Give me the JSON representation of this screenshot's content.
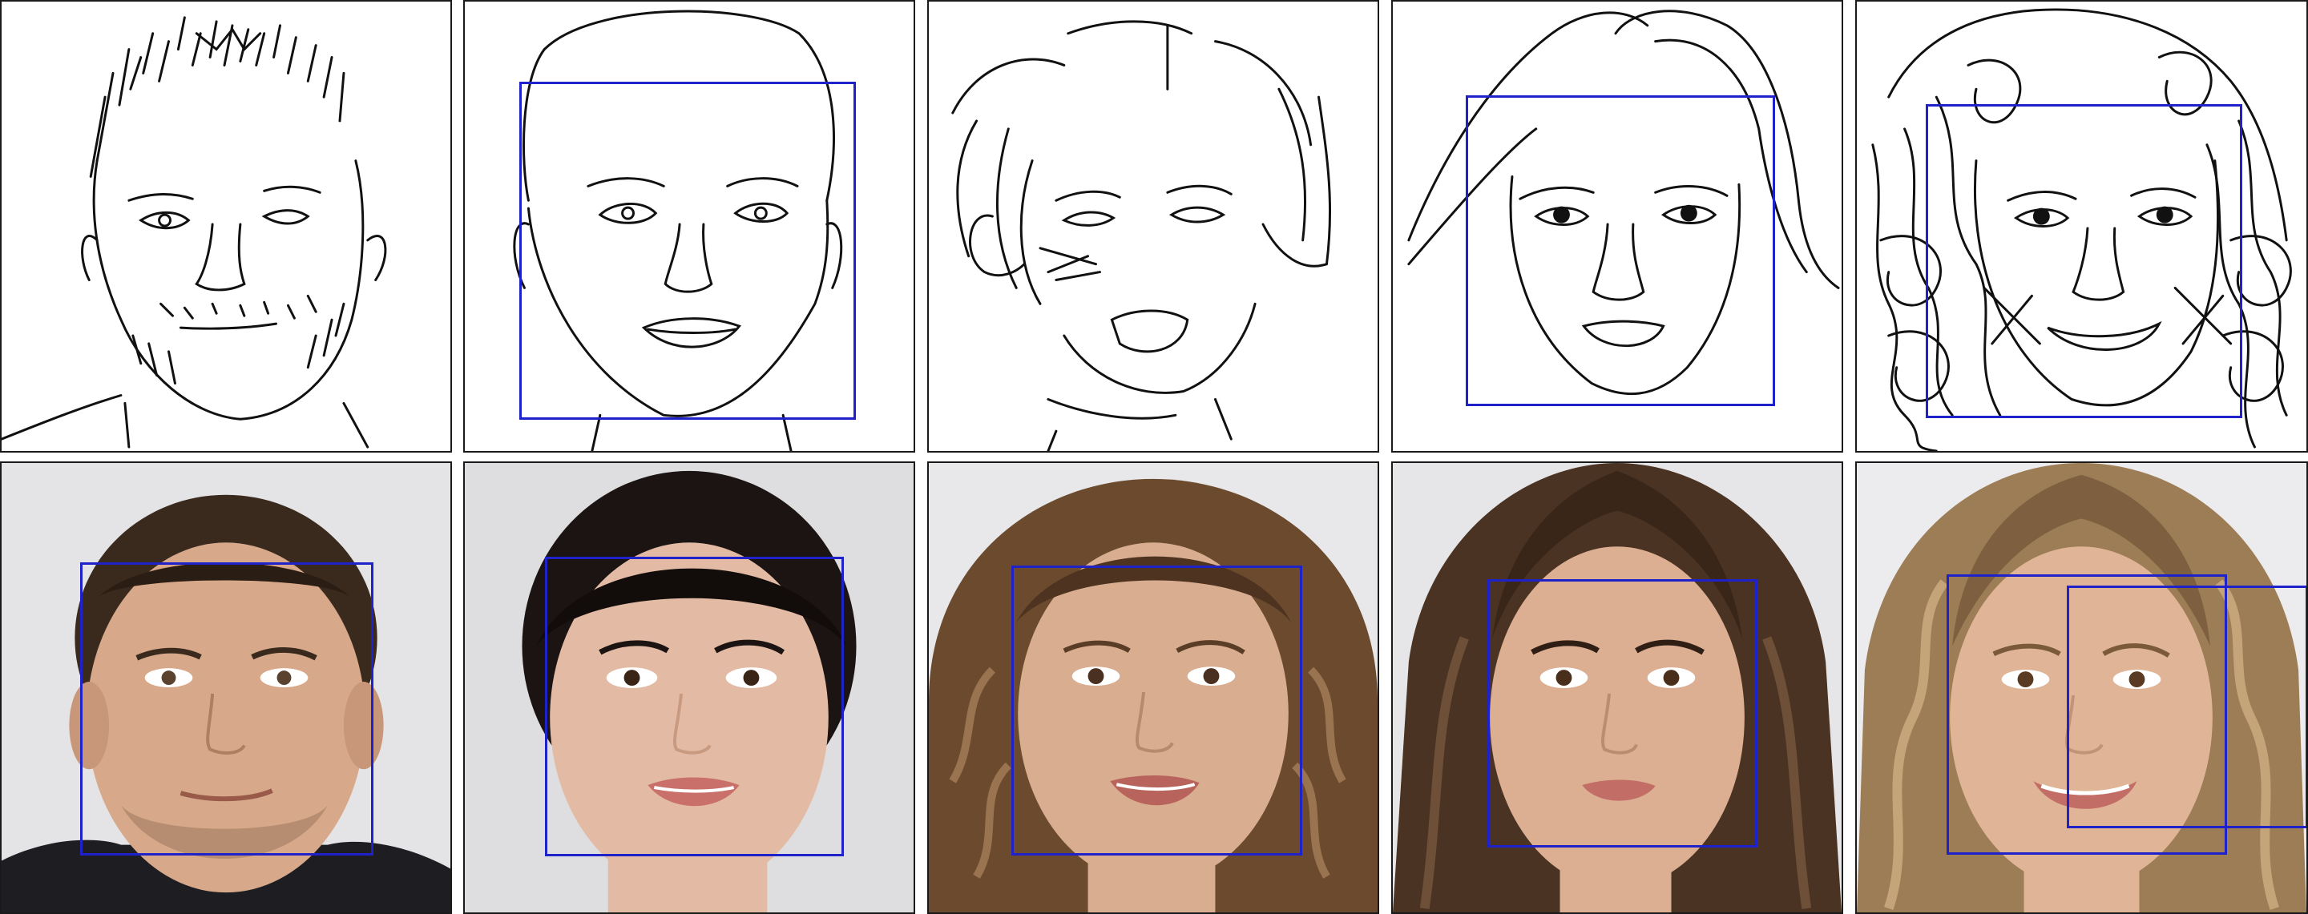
{
  "figure": {
    "rows": [
      {
        "kind": "sketch",
        "panels": [
          {
            "subject": "man-short-spiky-hair-stubble",
            "has_box": false
          },
          {
            "subject": "woman-slicked-hair",
            "has_box": true
          },
          {
            "subject": "woman-curly-hair-open-mouth",
            "has_box": false
          },
          {
            "subject": "woman-long-straight-hair",
            "has_box": true
          },
          {
            "subject": "woman-scribbled-curly-hair-smile",
            "has_box": true
          }
        ]
      },
      {
        "kind": "photo",
        "panels": [
          {
            "subject": "man-short-brown-hair",
            "hair": "#3a2a1e",
            "skin": "#d7a98a",
            "bg": "#e4e4e6",
            "has_box": true
          },
          {
            "subject": "woman-black-slicked-hair",
            "hair": "#1b1412",
            "skin": "#e3bba5",
            "bg": "#dedee0",
            "has_box": true
          },
          {
            "subject": "woman-curly-brown-hair",
            "hair": "#6b4a2e",
            "skin": "#d9ad90",
            "bg": "#e8e8ea",
            "has_box": true
          },
          {
            "subject": "woman-long-dark-hair",
            "hair": "#4a3322",
            "skin": "#dcae92",
            "bg": "#e6e6e8",
            "has_box": true
          },
          {
            "subject": "woman-wavy-blonde-hair",
            "hair": "#9d7d55",
            "skin": "#e0b597",
            "bg": "#ececee",
            "has_box": true
          }
        ]
      }
    ],
    "box_color": "#1e22c8"
  }
}
